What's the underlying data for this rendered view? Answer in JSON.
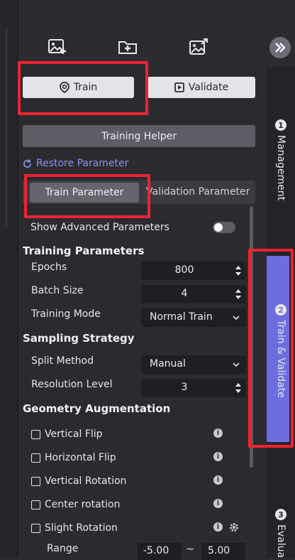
{
  "toolbar": {
    "icons": [
      "add-image-icon",
      "add-folder-icon",
      "export-image-icon"
    ],
    "expand_icon": "double-chevron-right-icon"
  },
  "mode_tabs": {
    "train_label": "Train",
    "validate_label": "Validate"
  },
  "training_helper_label": "Training Helper",
  "restore_label": "Restore Parameter",
  "param_tabs": {
    "train_label": "Train Parameter",
    "validation_label": "Validation Parameter"
  },
  "show_advanced": {
    "label": "Show Advanced Parameters",
    "enabled": false
  },
  "training_parameters": {
    "title": "Training Parameters",
    "epochs_label": "Epochs",
    "epochs_value": "800",
    "batch_size_label": "Batch Size",
    "batch_size_value": "4",
    "training_mode_label": "Training Mode",
    "training_mode_value": "Normal Train"
  },
  "sampling_strategy": {
    "title": "Sampling Strategy",
    "split_method_label": "Split Method",
    "split_method_value": "Manual",
    "resolution_label": "Resolution Level",
    "resolution_value": "3"
  },
  "geometry_augmentation": {
    "title": "Geometry Augmentation",
    "items": [
      {
        "label": "Vertical Flip",
        "checked": false
      },
      {
        "label": "Horizontal Flip",
        "checked": false
      },
      {
        "label": "Vertical Rotation",
        "checked": false
      },
      {
        "label": "Center rotation",
        "checked": false
      },
      {
        "label": "Slight Rotation",
        "checked": false
      }
    ],
    "range_label": "Range",
    "range_min": "-5.00",
    "range_sep": "~",
    "range_max": "5.00"
  },
  "rail": {
    "items": [
      {
        "number": "1",
        "label": "Management"
      },
      {
        "number": "2",
        "label": "Train & Validate"
      },
      {
        "number": "3",
        "label": "Evalua"
      }
    ]
  },
  "colors": {
    "accent": "#6c6ee0",
    "highlight": "#ee2232",
    "background": "#2b2b2f",
    "link": "#8f91f0"
  }
}
